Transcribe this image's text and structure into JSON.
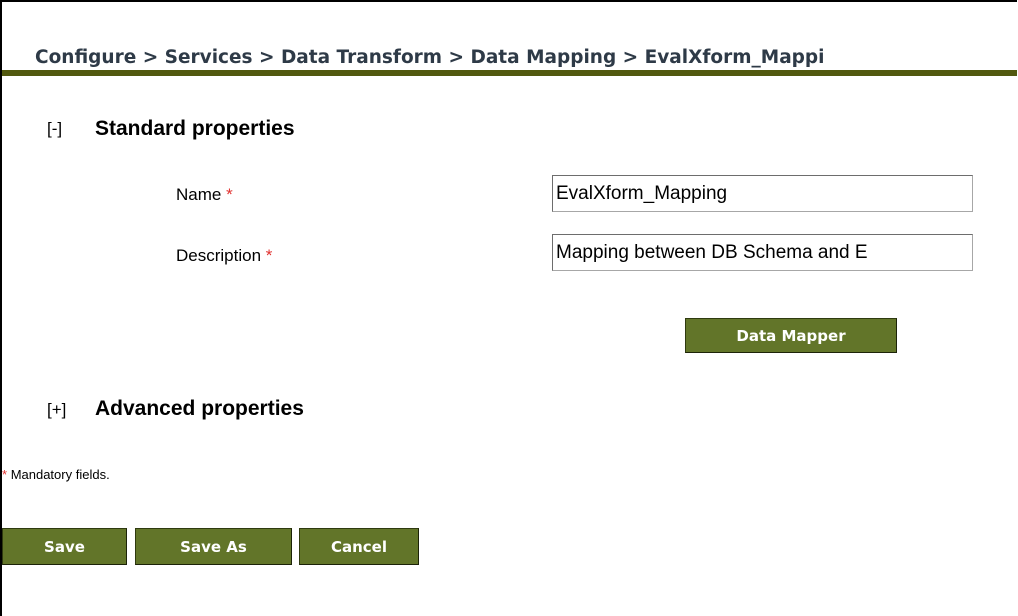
{
  "breadcrumb": "Configure > Services > Data Transform > Data Mapping > EvalXform_Mappi",
  "standard": {
    "toggle": "[-]",
    "title": "Standard properties",
    "name_label": "Name",
    "description_label": "Description",
    "required_marker": "*",
    "name_value": "EvalXform_Mapping",
    "description_value": "Mapping between DB Schema and E",
    "data_mapper_button": "Data Mapper"
  },
  "advanced": {
    "toggle": "[+]",
    "title": "Advanced properties"
  },
  "mandatory_note": "Mandatory fields.",
  "actions": {
    "save": "Save",
    "save_as": "Save As",
    "cancel": "Cancel"
  },
  "colors": {
    "button_bg": "#627529",
    "rule": "#52590f",
    "required": "#e0312f"
  }
}
